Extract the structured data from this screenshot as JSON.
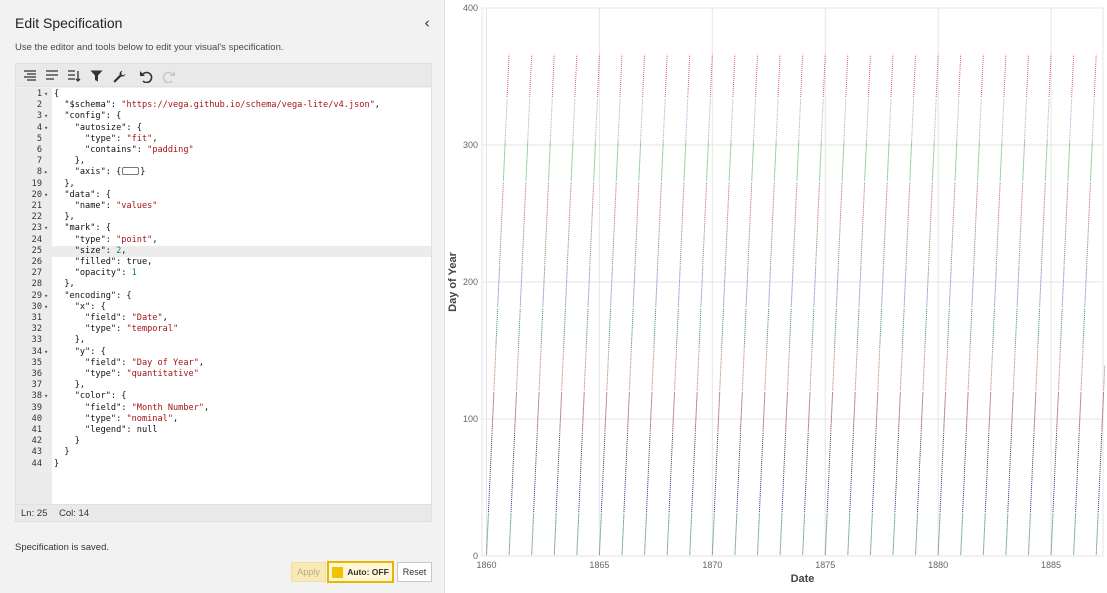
{
  "panel": {
    "title": "Edit Specification",
    "collapse_icon": "‹",
    "description": "Use the editor and tools below to edit your visual's specification."
  },
  "toolbar": {
    "icons": [
      "format-icon",
      "wrap-icon",
      "sort-icon",
      "filter-icon",
      "settings-wrench-icon",
      "undo-icon",
      "redo-icon"
    ]
  },
  "editor": {
    "active_line": 25,
    "lines": [
      {
        "n": "1",
        "fold": "▾",
        "code": [
          [
            "{",
            "k"
          ]
        ]
      },
      {
        "n": "2",
        "fold": "",
        "code": [
          [
            "  \"$schema\": ",
            "k"
          ],
          [
            "\"https://vega.github.io/schema/vega-lite/v4.json\"",
            "s"
          ],
          [
            ",",
            "k"
          ]
        ]
      },
      {
        "n": "3",
        "fold": "▾",
        "code": [
          [
            "  \"config\": {",
            "k"
          ]
        ]
      },
      {
        "n": "4",
        "fold": "▾",
        "code": [
          [
            "    \"autosize\": {",
            "k"
          ]
        ]
      },
      {
        "n": "5",
        "fold": "",
        "code": [
          [
            "      \"type\": ",
            "k"
          ],
          [
            "\"fit\"",
            "s"
          ],
          [
            ",",
            "k"
          ]
        ]
      },
      {
        "n": "6",
        "fold": "",
        "code": [
          [
            "      \"contains\": ",
            "k"
          ],
          [
            "\"padding\"",
            "s"
          ]
        ]
      },
      {
        "n": "7",
        "fold": "",
        "code": [
          [
            "    },",
            "k"
          ]
        ]
      },
      {
        "n": "8",
        "fold": "▸",
        "code": [
          [
            "    \"axis\": {",
            "k"
          ],
          [
            "",
            "coll"
          ],
          [
            "}",
            "k"
          ]
        ]
      },
      {
        "n": "19",
        "fold": "",
        "code": [
          [
            "  },",
            "k"
          ]
        ]
      },
      {
        "n": "20",
        "fold": "▾",
        "code": [
          [
            "  \"data\": {",
            "k"
          ]
        ]
      },
      {
        "n": "21",
        "fold": "",
        "code": [
          [
            "    \"name\": ",
            "k"
          ],
          [
            "\"values\"",
            "s"
          ]
        ]
      },
      {
        "n": "22",
        "fold": "",
        "code": [
          [
            "  },",
            "k"
          ]
        ]
      },
      {
        "n": "23",
        "fold": "▾",
        "code": [
          [
            "  \"mark\": {",
            "k"
          ]
        ]
      },
      {
        "n": "24",
        "fold": "",
        "code": [
          [
            "    \"type\": ",
            "k"
          ],
          [
            "\"point\"",
            "s"
          ],
          [
            ",",
            "k"
          ]
        ]
      },
      {
        "n": "25",
        "fold": "",
        "code": [
          [
            "    \"size\": ",
            "k"
          ],
          [
            "2",
            "n"
          ],
          [
            ",",
            "k"
          ]
        ]
      },
      {
        "n": "26",
        "fold": "",
        "code": [
          [
            "    \"filled\": ",
            "k"
          ],
          [
            "true",
            "kw"
          ],
          [
            ",",
            "k"
          ]
        ]
      },
      {
        "n": "27",
        "fold": "",
        "code": [
          [
            "    \"opacity\": ",
            "k"
          ],
          [
            "1",
            "n"
          ]
        ]
      },
      {
        "n": "28",
        "fold": "",
        "code": [
          [
            "  },",
            "k"
          ]
        ]
      },
      {
        "n": "29",
        "fold": "▾",
        "code": [
          [
            "  \"encoding\": {",
            "k"
          ]
        ]
      },
      {
        "n": "30",
        "fold": "▾",
        "code": [
          [
            "    \"x\": {",
            "k"
          ]
        ]
      },
      {
        "n": "31",
        "fold": "",
        "code": [
          [
            "      \"field\": ",
            "k"
          ],
          [
            "\"Date\"",
            "s"
          ],
          [
            ",",
            "k"
          ]
        ]
      },
      {
        "n": "32",
        "fold": "",
        "code": [
          [
            "      \"type\": ",
            "k"
          ],
          [
            "\"temporal\"",
            "s"
          ]
        ]
      },
      {
        "n": "33",
        "fold": "",
        "code": [
          [
            "    },",
            "k"
          ]
        ]
      },
      {
        "n": "34",
        "fold": "▾",
        "code": [
          [
            "    \"y\": {",
            "k"
          ]
        ]
      },
      {
        "n": "35",
        "fold": "",
        "code": [
          [
            "      \"field\": ",
            "k"
          ],
          [
            "\"Day of Year\"",
            "s"
          ],
          [
            ",",
            "k"
          ]
        ]
      },
      {
        "n": "36",
        "fold": "",
        "code": [
          [
            "      \"type\": ",
            "k"
          ],
          [
            "\"quantitative\"",
            "s"
          ]
        ]
      },
      {
        "n": "37",
        "fold": "",
        "code": [
          [
            "    },",
            "k"
          ]
        ]
      },
      {
        "n": "38",
        "fold": "▾",
        "code": [
          [
            "    \"color\": {",
            "k"
          ]
        ]
      },
      {
        "n": "39",
        "fold": "",
        "code": [
          [
            "      \"field\": ",
            "k"
          ],
          [
            "\"Month Number\"",
            "s"
          ],
          [
            ",",
            "k"
          ]
        ]
      },
      {
        "n": "40",
        "fold": "",
        "code": [
          [
            "      \"type\": ",
            "k"
          ],
          [
            "\"nominal\"",
            "s"
          ],
          [
            ",",
            "k"
          ]
        ]
      },
      {
        "n": "41",
        "fold": "",
        "code": [
          [
            "      \"legend\": ",
            "k"
          ],
          [
            "null",
            "kw"
          ]
        ]
      },
      {
        "n": "42",
        "fold": "",
        "code": [
          [
            "    }",
            "k"
          ]
        ]
      },
      {
        "n": "43",
        "fold": "",
        "code": [
          [
            "  }",
            "k"
          ]
        ]
      },
      {
        "n": "44",
        "fold": "",
        "code": [
          [
            "}",
            "k"
          ]
        ]
      }
    ]
  },
  "status": {
    "line_label": "Ln: 25",
    "col_label": "Col: 14",
    "saved_message": "Specification is saved."
  },
  "buttons": {
    "apply": "Apply",
    "auto": "Auto: OFF",
    "reset": "Reset"
  },
  "colors": {
    "month_palette": [
      "#1f6f2a",
      "#2a2a7a",
      "#3a3a3a",
      "#7a2020",
      "#b07a5a",
      "#3a8a4a",
      "#6a6ab0",
      "#9a7a5a",
      "#c05a7a",
      "#4aa04a",
      "#b0a0d0",
      "#e05a7a"
    ]
  },
  "chart_data": {
    "type": "scatter",
    "xlabel": "Date",
    "ylabel": "Day of Year",
    "x_ticks": [
      "1860",
      "1865",
      "1870",
      "1875",
      "1880",
      "1885"
    ],
    "y_ticks": [
      "0",
      "100",
      "200",
      "300",
      "400"
    ],
    "xlim": [
      1859.8,
      1887.3
    ],
    "ylim": [
      0,
      400
    ],
    "grid": true,
    "legend": null,
    "series_description": "Each year forms a diagonal streak from day 1 to day 366, colored by Month Number (1-12)",
    "years_start": 1860,
    "years_end": 1887,
    "last_partial_day": 139
  }
}
